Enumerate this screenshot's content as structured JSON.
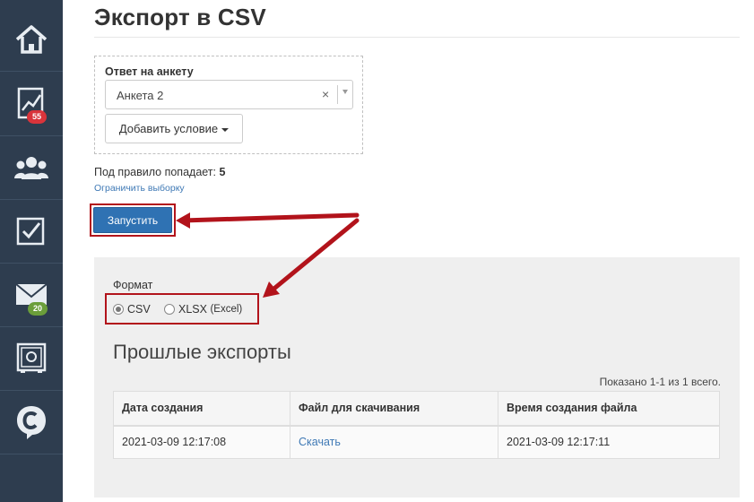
{
  "sidebar": {
    "items": [
      {
        "name": "home",
        "icon": "home-icon"
      },
      {
        "name": "analytics",
        "icon": "chart-icon",
        "badge": "55",
        "badge_color": "#d9343b"
      },
      {
        "name": "users",
        "icon": "users-icon"
      },
      {
        "name": "tasks",
        "icon": "checkbox-icon"
      },
      {
        "name": "mail",
        "icon": "mail-icon",
        "badge": "20",
        "badge_color": "#6b9e3a"
      },
      {
        "name": "safe",
        "icon": "safe-icon"
      },
      {
        "name": "chat",
        "icon": "chat-c-icon"
      }
    ]
  },
  "page": {
    "title": "Экспорт в CSV"
  },
  "filter": {
    "label": "Ответ на анкету",
    "selected_value": "Анкета 2",
    "clear_symbol": "×",
    "add_condition_label": "Добавить условие"
  },
  "rule": {
    "count_label": "Под правило попадает:",
    "count_value": "5",
    "limit_link": "Ограничить выборку"
  },
  "run_button": {
    "label": "Запустить"
  },
  "export": {
    "format_label": "Формат",
    "options": [
      {
        "label": "CSV",
        "checked": true
      },
      {
        "label": "XLSX",
        "sub": "(Excel)",
        "checked": false
      }
    ],
    "past_title": "Прошлые экспорты",
    "shown_info": "Показано 1-1 из 1 всего.",
    "table": {
      "headers": [
        "Дата создания",
        "Файл для скачивания",
        "Время создания файла"
      ],
      "rows": [
        {
          "created": "2021-03-09 12:17:08",
          "file": "Скачать",
          "file_time": "2021-03-09 12:17:11"
        }
      ]
    }
  },
  "colors": {
    "sidebar_bg": "#2e3d4f",
    "primary_button": "#2f72b3",
    "highlight": "#b2131b",
    "link": "#3f79b5"
  }
}
